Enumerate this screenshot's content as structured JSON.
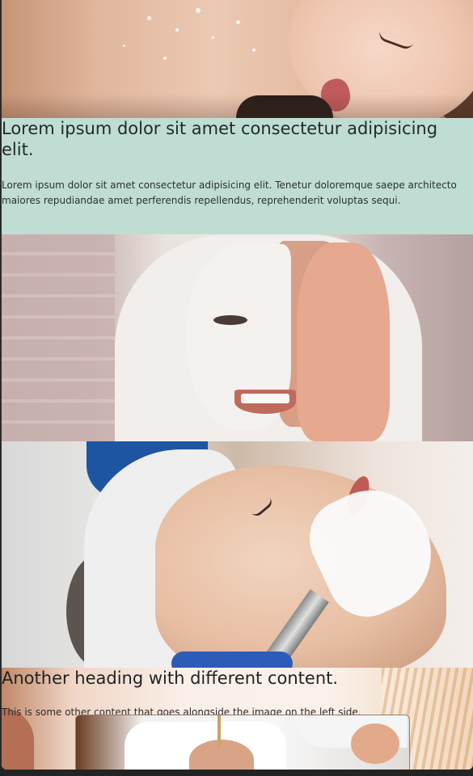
{
  "sections": [
    {
      "image_alt": "Woman relaxing during a massage with salt scrub on her back",
      "heading": "Lorem ipsum dolor sit amet consectetur adipisicing elit.",
      "body": "Lorem ipsum dolor sit amet consectetur adipisicing elit. Tenetur doloremque saepe architecto maiores repudiandae amet perferendis repellendus, reprehenderit voluptas sequi."
    },
    {
      "image_alt": "Smiling woman with face mask covering one side of her face"
    },
    {
      "image_alt": "Woman receiving a facial treatment applied with a brush"
    },
    {
      "heading": "Another heading with different content.",
      "body": "This is some other content that goes alongside the image on the left side.",
      "image_alt": "Woman receiving a face treatment"
    }
  ],
  "colors": {
    "text_block_bg": "#c0ddd4",
    "page_bg": "#1b1b1b",
    "heading_color": "#1e2a2a"
  }
}
